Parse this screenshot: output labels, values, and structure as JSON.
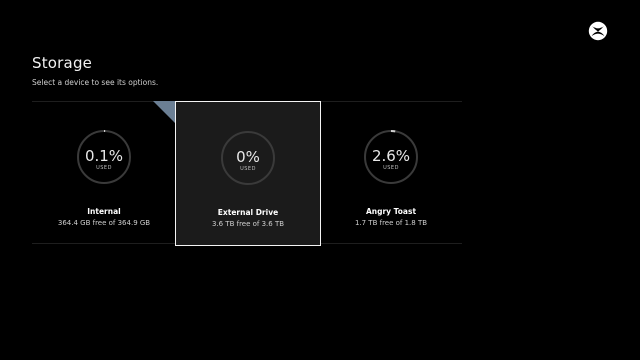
{
  "header": {
    "title": "Storage",
    "subtitle": "Select a device to see its options."
  },
  "devices": [
    {
      "name": "Internal",
      "percent_label": "0.1%",
      "used_label": "USED",
      "free_text": "364.4 GB free of 364.9 GB",
      "used_fraction": 0.001
    },
    {
      "name": "External Drive",
      "percent_label": "0%",
      "used_label": "USED",
      "free_text": "3.6 TB free of 3.6 TB",
      "used_fraction": 0.0,
      "selected": true
    },
    {
      "name": "Angry Toast",
      "percent_label": "2.6%",
      "used_label": "USED",
      "free_text": "1.7 TB free of 1.8 TB",
      "used_fraction": 0.026
    }
  ],
  "colors": {
    "ring_track": "#3a3a3a",
    "ring_fill": "#cfcfcf",
    "flag": "#6b7f94",
    "selection_border": "#f4f4f4"
  },
  "icons": {
    "logo": "xbox-logo-icon"
  }
}
